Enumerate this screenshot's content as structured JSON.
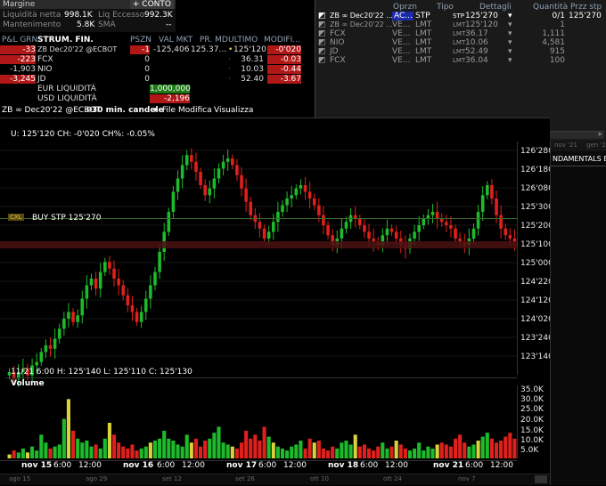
{
  "account": {
    "title": "Margine",
    "conto_button": "+ CONTO",
    "net_liq_label": "Liquidità netta",
    "net_liq_value": "998.1K",
    "excess_label": "Liq Eccesso",
    "excess_value": "992.3K",
    "maint_label": "Mantenimento",
    "maint_value": "5.8K",
    "sma_label": "SMA",
    "sma_value": "--"
  },
  "portfolio": {
    "headers": [
      "P&L GRN",
      "STRUM. FIN.",
      "PSZN",
      "VAL MKT",
      "PR. MD",
      "ULTIMO",
      "MODIFI..."
    ],
    "rows": [
      {
        "pnl": "-33",
        "symbol": "ZB Dec20'22 @ECBOT",
        "pos": "-1",
        "mkt": "-125,406",
        "avg": "125.37...",
        "last": "125'120",
        "chg": "-0'020"
      },
      {
        "pnl": "-223",
        "symbol": "FCX",
        "pos": "0",
        "mkt": "",
        "avg": "",
        "last": "36.31",
        "chg": "-0.03"
      },
      {
        "pnl": "-1,903",
        "symbol": "NIO",
        "pos": "0",
        "mkt": "",
        "avg": "",
        "last": "10.03",
        "chg": "-0.44"
      },
      {
        "pnl": "-3,245",
        "symbol": "JD",
        "pos": "0",
        "mkt": "",
        "avg": "",
        "last": "52.40",
        "chg": "-3.67"
      }
    ],
    "eur_label": "EUR LIQUIDITÀ",
    "eur_value": "1,000,000",
    "usd_label": "USD LIQUIDITÀ",
    "usd_value": "-2,196"
  },
  "orders": {
    "headers": [
      "Oprzn",
      "Tipo",
      "Dettagli",
      "Quantità",
      "Przz stp"
    ],
    "rows": [
      {
        "symbol": "ZB ∞ Dec20'22 ...",
        "action": "AC...",
        "type": "STP",
        "dtag": "STP",
        "detail": "125'270",
        "qty": "0/1",
        "stop": "125'270"
      },
      {
        "symbol": "ZB ∞ Dec20'22 ...",
        "action": "VE...",
        "type": "LMT",
        "dtag": "LMT",
        "detail": "125'120",
        "qty": "1",
        "stop": ""
      },
      {
        "symbol": "FCX",
        "action": "VE...",
        "type": "LMT",
        "dtag": "LMT",
        "detail": "36.17",
        "qty": "1,111",
        "stop": ""
      },
      {
        "symbol": "NIO",
        "action": "VE...",
        "type": "LMT",
        "dtag": "LMT",
        "detail": "10.06",
        "qty": "4,581",
        "stop": ""
      },
      {
        "symbol": "JD",
        "action": "VE...",
        "type": "LMT",
        "dtag": "LMT",
        "detail": "52.49",
        "qty": "915",
        "stop": ""
      },
      {
        "symbol": "FCX",
        "action": "VE...",
        "type": "LMT",
        "dtag": "LMT",
        "detail": "36.04",
        "qty": "100",
        "stop": ""
      }
    ]
  },
  "chart_toolbar": {
    "symbol": "ZB ∞ Dec20'22 @ECBOT",
    "interval": "30 min. candele",
    "menu_file": "File",
    "menu_edit": "Modifica",
    "menu_view": "Visualizza"
  },
  "chart_info": {
    "top_readout": "U: 125'120 CH: -0'020 CH%: -0.05%",
    "bottom_readout": "11/21 6:00  H: 125'140  L: 125'110  C: 125'130",
    "stop_tag": "CXL",
    "stop_label": "BUY STP 125'270",
    "volume_label": "Volume",
    "side_text": "NDAMENTALS EXP"
  },
  "chart_data": {
    "type": "candlestick",
    "price_ticks": [
      "126'280",
      "126'180",
      "126'080",
      "125'300",
      "125'200",
      "125'100",
      "125'000",
      "124'220",
      "124'120",
      "124'020",
      "123'240",
      "123'140"
    ],
    "volume_ticks": [
      "35.0K",
      "30.0K",
      "25.0K",
      "20.0K",
      "15.0K",
      "10.0K",
      "5.0K"
    ],
    "x_ticks": [
      {
        "day": "nov 15",
        "time": "6:00",
        "time2": "12:00"
      },
      {
        "day": "nov 16",
        "time": "6:00",
        "time2": "12:00"
      },
      {
        "day": "nov 17",
        "time": "6:00",
        "time2": "12:00"
      },
      {
        "day": "nov 18",
        "time": "6:00",
        "time2": "12:00"
      },
      {
        "day": "nov 21",
        "time": "6:00",
        "time2": "12:00"
      }
    ],
    "mini_ticks": [
      "ago 15",
      "ago 29",
      "set 12",
      "set 26",
      "ott 10",
      "ott 24",
      "nov 7"
    ],
    "right_mini_ticks": [
      "nov '21",
      "gen '2"
    ],
    "stop_price": "125'270",
    "last_price": "125'120",
    "closes": [
      123.2,
      123.1,
      123.2,
      123.25,
      123.15,
      123.3,
      123.35,
      123.5,
      123.6,
      123.55,
      123.7,
      123.85,
      124.0,
      124.1,
      123.95,
      124.05,
      124.3,
      124.5,
      124.6,
      124.45,
      124.7,
      124.85,
      124.75,
      124.6,
      124.5,
      124.35,
      124.2,
      124.1,
      123.95,
      124.1,
      124.3,
      124.5,
      124.7,
      125.0,
      125.3,
      125.6,
      125.9,
      126.1,
      126.3,
      126.45,
      126.35,
      126.2,
      126.0,
      125.85,
      125.95,
      126.1,
      126.25,
      126.35,
      126.4,
      126.3,
      126.15,
      125.95,
      125.75,
      125.55,
      125.45,
      125.35,
      125.2,
      125.3,
      125.45,
      125.6,
      125.7,
      125.8,
      125.85,
      125.95,
      126.0,
      125.9,
      125.8,
      125.7,
      125.55,
      125.4,
      125.25,
      125.1,
      125.2,
      125.35,
      125.45,
      125.55,
      125.5,
      125.4,
      125.3,
      125.2,
      125.15,
      125.1,
      125.25,
      125.35,
      125.3,
      125.2,
      125.1,
      125.05,
      125.2,
      125.3,
      125.4,
      125.5,
      125.55,
      125.6,
      125.5,
      125.45,
      125.4,
      125.35,
      125.2,
      125.15,
      125.1,
      125.2,
      125.35,
      125.6,
      125.85,
      126.0,
      125.8,
      125.55,
      125.35,
      125.25,
      125.2,
      125.15
    ],
    "volumes": [
      2,
      4,
      3,
      5,
      3,
      6,
      4,
      12,
      8,
      5,
      6,
      7,
      20,
      30,
      14,
      10,
      8,
      9,
      6,
      7,
      5,
      10,
      18,
      12,
      8,
      6,
      5,
      7,
      4,
      5,
      6,
      8,
      9,
      10,
      14,
      10,
      9,
      7,
      6,
      12,
      8,
      10,
      6,
      9,
      10,
      13,
      16,
      8,
      7,
      6,
      5,
      8,
      14,
      10,
      12,
      9,
      16,
      11,
      8,
      6,
      5,
      4,
      6,
      7,
      9,
      5,
      10,
      8,
      9,
      5,
      4,
      6,
      5,
      8,
      9,
      7,
      12,
      6,
      7,
      5,
      4,
      6,
      8,
      5,
      6,
      9,
      7,
      5,
      4,
      5,
      8,
      4,
      6,
      5,
      7,
      8,
      7,
      6,
      10,
      12,
      8,
      6,
      7,
      9,
      11,
      13,
      10,
      8,
      9,
      11,
      13,
      10
    ]
  },
  "colors": {
    "up": "#1dbb2c",
    "down": "#e0201c",
    "neutral": "#d9d23a",
    "stop_line": "#3a7a2a",
    "last_band": "#4a1010"
  }
}
